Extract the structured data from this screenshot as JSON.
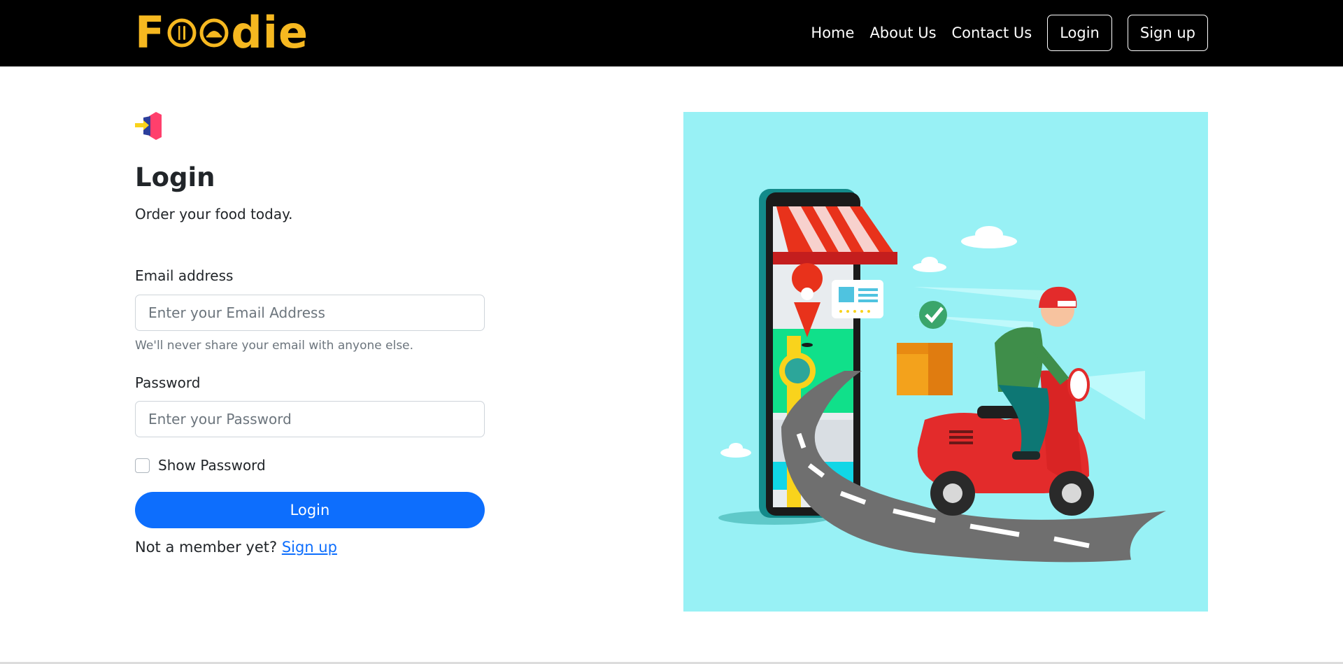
{
  "navbar": {
    "brand": {
      "first": "F",
      "rest": "die"
    },
    "links": [
      "Home",
      "About Us",
      "Contact Us"
    ],
    "login_label": "Login",
    "signup_label": "Sign up"
  },
  "login": {
    "title": "Login",
    "subtitle": "Order your food today.",
    "email_label": "Email address",
    "email_placeholder": "Enter your Email Address",
    "email_help": "We'll never share your email with anyone else.",
    "password_label": "Password",
    "password_placeholder": "Enter your Password",
    "show_password_label": "Show Password",
    "submit_label": "Login",
    "not_member_text": "Not a member yet?",
    "signup_link": "Sign up"
  },
  "colors": {
    "navbar_bg": "#000000",
    "brand": "#f6b820",
    "primary": "#0d6efd",
    "hero_bg": "#98f1f5"
  },
  "icons": {
    "login_icon": "login-arrow-icon",
    "hero": "delivery-illustration"
  }
}
